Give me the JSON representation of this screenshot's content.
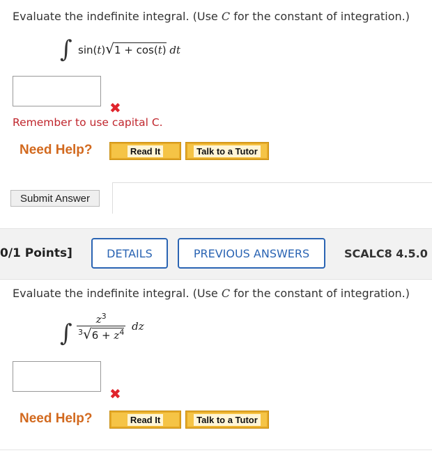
{
  "q1": {
    "prompt_pre": "Evaluate the indefinite integral. (Use ",
    "prompt_var": "C",
    "prompt_post": " for the constant of integration.)",
    "integral_sign": "∫",
    "integrand_pre": "sin(",
    "integrand_var": "t",
    "integrand_mid": ")",
    "radical": "√",
    "radicand_pre": "1 + cos(",
    "radicand_var": "t",
    "radicand_post": ")",
    "differential": "dt",
    "answer_value": "",
    "incorrect_mark": "✖",
    "hint": "Remember to use capital C.",
    "need_help": "Need Help?",
    "read_it": "Read It",
    "talk_to_tutor": "Talk to a Tutor",
    "submit_label": "Submit Answer"
  },
  "q2": {
    "points": "0/1 Points]",
    "details_label": "DETAILS",
    "previous_answers_label": "PREVIOUS ANSWERS",
    "source_label": "SCALC8 4.5.0",
    "prompt_pre": "Evaluate the indefinite integral. (Use ",
    "prompt_var": "C",
    "prompt_post": " for the constant of integration.)",
    "integral_sign": "∫",
    "numerator_base": "z",
    "numerator_exp": "3",
    "root_index": "3",
    "radical": "√",
    "radicand_pre": "6 + ",
    "radicand_base": "z",
    "radicand_exp": "4",
    "differential": "dz",
    "answer_value": "",
    "incorrect_mark": "✖",
    "need_help": "Need Help?",
    "read_it": "Read It",
    "talk_to_tutor": "Talk to a Tutor"
  },
  "colors": {
    "accent": "#2a64b3",
    "error": "#e0242c",
    "need_help": "#d2691e",
    "help_button": "#f5c446"
  }
}
